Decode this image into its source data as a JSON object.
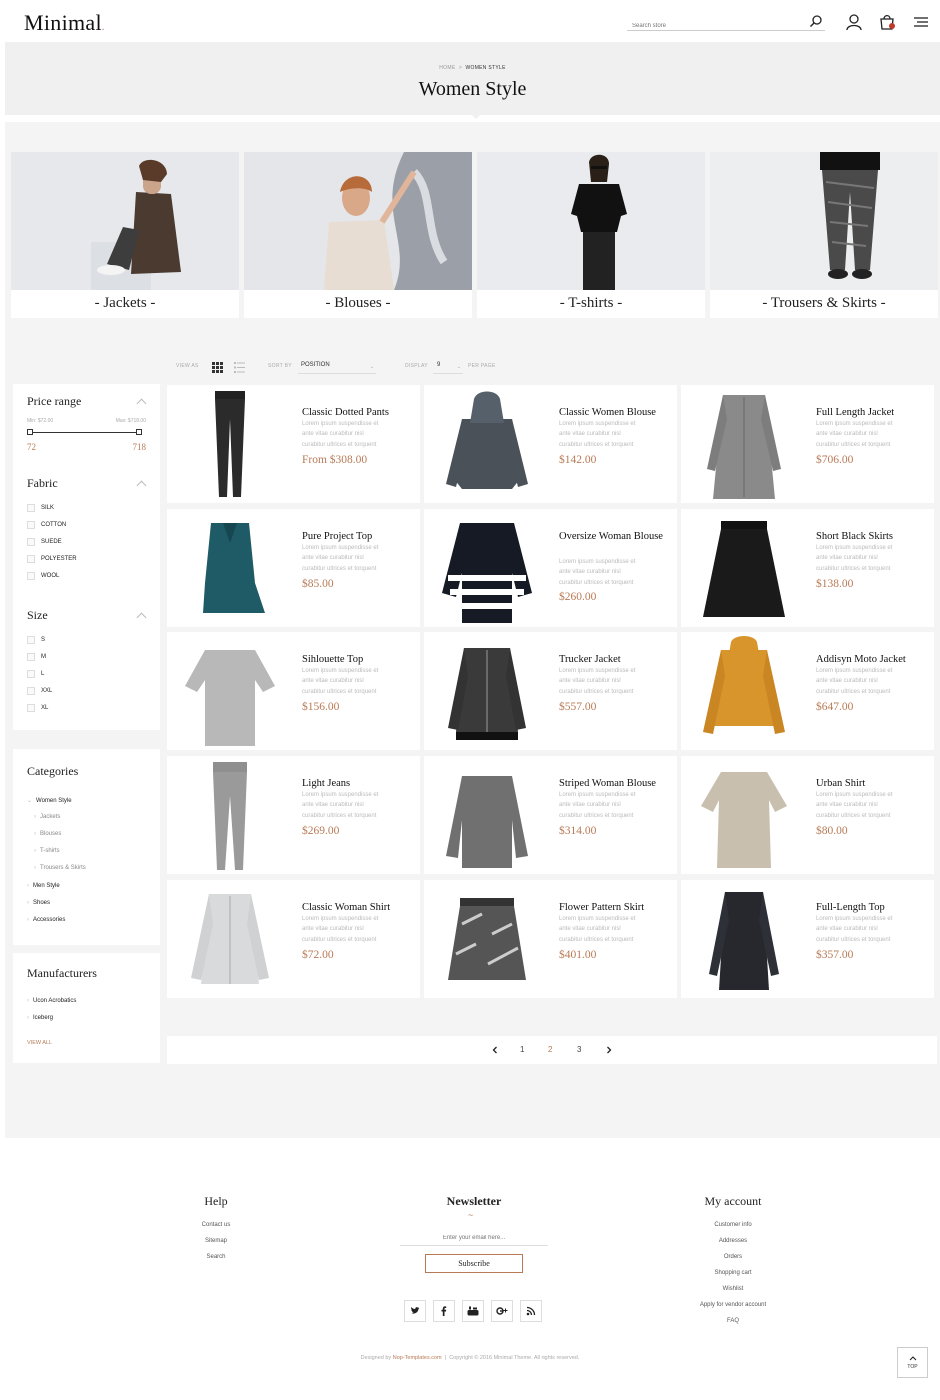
{
  "header": {
    "logo": "Minimal",
    "search_placeholder": "Search store"
  },
  "breadcrumb": {
    "home": "HOME",
    "sep": ">",
    "current": "WOMEN STYLE"
  },
  "page_title": "Women Style",
  "category_tiles": [
    "- Jackets -",
    "- Blouses -",
    "- T-shirts -",
    "- Trousers & Skirts -"
  ],
  "toolbar": {
    "view_as": "VIEW AS",
    "sort_by": "SORT BY",
    "sort_value": "POSITION",
    "display": "DISPLAY",
    "display_value": "9",
    "per_page": "PER PAGE"
  },
  "filters": {
    "price_title": "Price range",
    "min_label": "Min: $72.00",
    "max_label": "Max: $718.00",
    "min_value": "72",
    "max_value": "718",
    "fabric_title": "Fabric",
    "fabric": [
      "SILK",
      "COTTON",
      "SUEDE",
      "POLYESTER",
      "WOOL"
    ],
    "size_title": "Size",
    "sizes": [
      "S",
      "M",
      "L",
      "XXL",
      "XL"
    ]
  },
  "categories": {
    "title": "Categories",
    "items": [
      {
        "label": "Women Style",
        "sub": false
      },
      {
        "label": "Jackets",
        "sub": true
      },
      {
        "label": "Blouses",
        "sub": true
      },
      {
        "label": "T-shirts",
        "sub": true
      },
      {
        "label": "Trousers & Skirts",
        "sub": true
      },
      {
        "label": "Men Style",
        "sub": false
      },
      {
        "label": "Shoes",
        "sub": false
      },
      {
        "label": "Accessories",
        "sub": false
      }
    ]
  },
  "manufacturers": {
    "title": "Manufacturers",
    "items": [
      "Ucon Acrobatics",
      "Iceberg"
    ],
    "view_all": "VIEW ALL"
  },
  "product_desc": [
    "Lorem ipsum suspendisse et",
    "ante vitae curabitur nisl",
    "curabitur ultrices et torquent"
  ],
  "products": [
    {
      "name": "Classic Dotted Pants",
      "price": "From $308.00"
    },
    {
      "name": "Classic Women Blouse",
      "price": "$142.00"
    },
    {
      "name": "Full Length Jacket",
      "price": "$706.00"
    },
    {
      "name": "Pure Project Top",
      "price": "$85.00"
    },
    {
      "name": "Oversize Woman Blouse",
      "price": "$260.00"
    },
    {
      "name": "Short Black Skirts",
      "price": "$138.00"
    },
    {
      "name": "Sihlouette Top",
      "price": "$156.00"
    },
    {
      "name": "Trucker Jacket",
      "price": "$557.00"
    },
    {
      "name": "Addisyn Moto Jacket",
      "price": "$647.00"
    },
    {
      "name": "Light Jeans",
      "price": "$269.00"
    },
    {
      "name": "Striped Woman Blouse",
      "price": "$314.00"
    },
    {
      "name": "Urban Shirt",
      "price": "$80.00"
    },
    {
      "name": "Classic Woman Shirt",
      "price": "$72.00"
    },
    {
      "name": "Flower Pattern Skirt",
      "price": "$401.00"
    },
    {
      "name": "Full-Length Top",
      "price": "$357.00"
    }
  ],
  "pager": {
    "pages": [
      "1",
      "2",
      "3"
    ],
    "current": "2"
  },
  "footer": {
    "help_title": "Help",
    "help_links": [
      "Contact us",
      "Sitemap",
      "Search"
    ],
    "newsletter_title": "Newsletter",
    "newsletter_placeholder": "Enter your email here...",
    "subscribe": "Subscribe",
    "account_title": "My account",
    "account_links": [
      "Customer info",
      "Addresses",
      "Orders",
      "Shopping cart",
      "Wishlist",
      "Apply for vendor account",
      "FAQ"
    ],
    "designed_by": "Designed by",
    "designer": "Nop-Templates.com",
    "copyright": "Copyright © 2016 Minimal Theme. All rights reserved.",
    "top": "TOP"
  },
  "colors": {
    "accent": "#b87a56",
    "band": "#f0f0f0",
    "page_gray": "#f4f4f4"
  }
}
